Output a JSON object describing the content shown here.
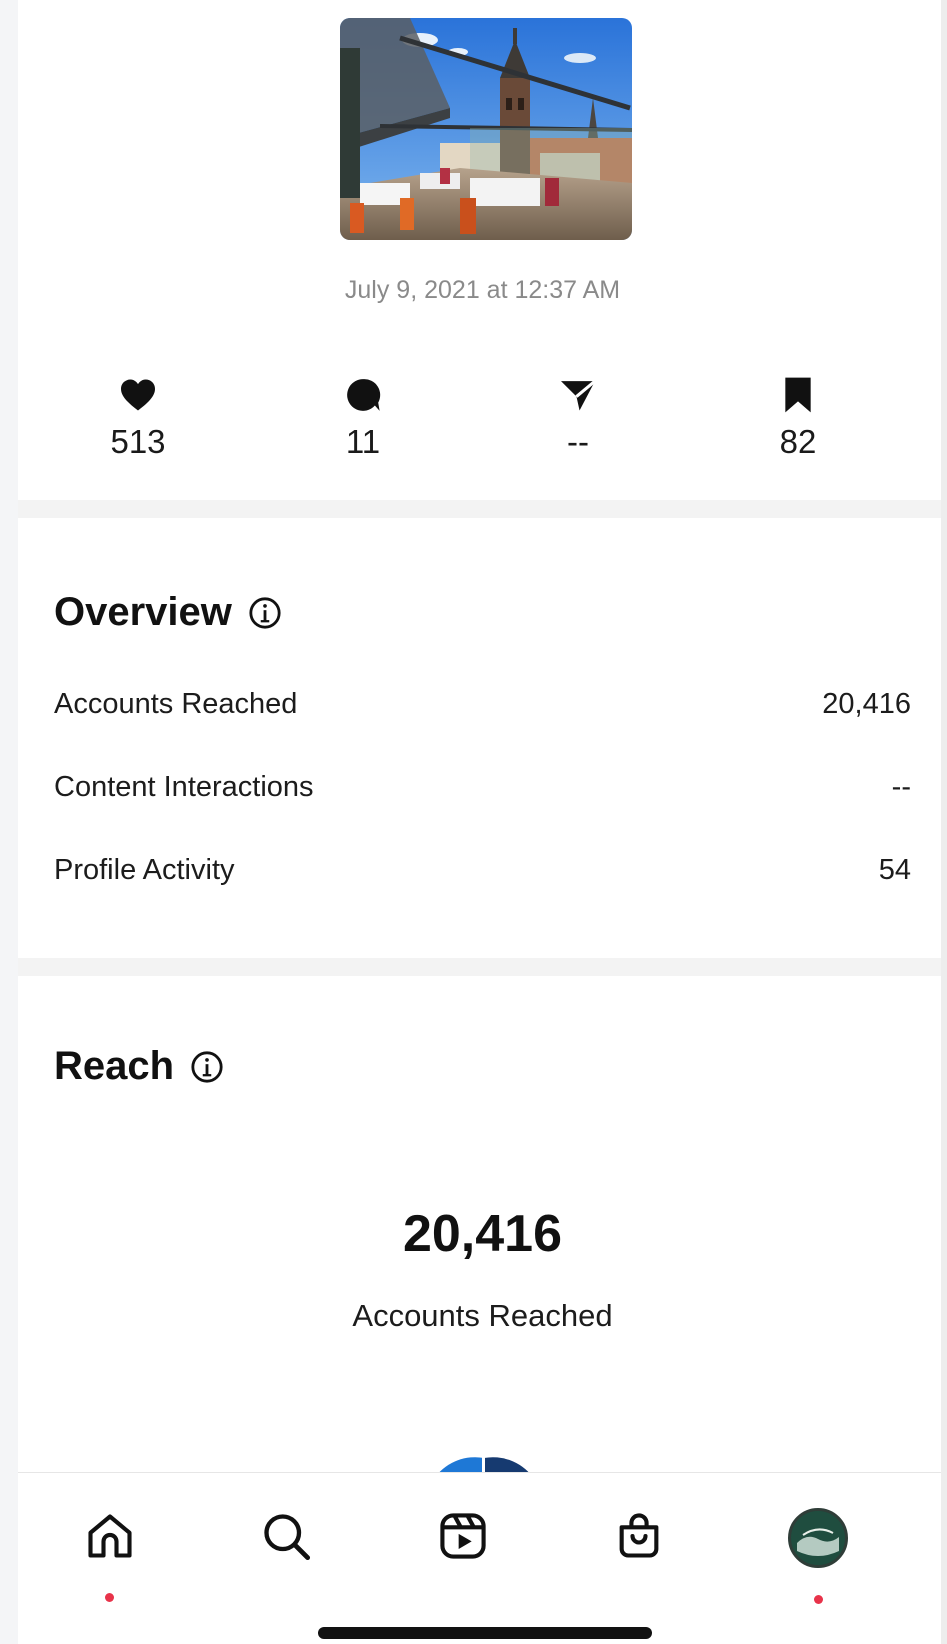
{
  "post": {
    "image_alt": "Rooftop terrace restaurant with church tower",
    "date": "July 9, 2021 at 12:37 AM"
  },
  "stats": [
    {
      "icon": "heart-icon",
      "value": "513"
    },
    {
      "icon": "comment-icon",
      "value": "11"
    },
    {
      "icon": "share-icon",
      "value": "--"
    },
    {
      "icon": "bookmark-icon",
      "value": "82"
    }
  ],
  "overview": {
    "title": "Overview",
    "rows": [
      {
        "label": "Accounts Reached",
        "value": "20,416"
      },
      {
        "label": "Content Interactions",
        "value": "--"
      },
      {
        "label": "Profile Activity",
        "value": "54"
      }
    ]
  },
  "reach": {
    "title": "Reach",
    "number": "20,416",
    "label": "Accounts Reached"
  },
  "tabbar": {
    "items": [
      "home-icon",
      "search-icon",
      "reels-icon",
      "shop-icon",
      "profile-avatar"
    ],
    "notification_color": "#e8334a"
  },
  "colors": {
    "accent_blue": "#1e78d6",
    "dark_blue": "#163a70"
  }
}
